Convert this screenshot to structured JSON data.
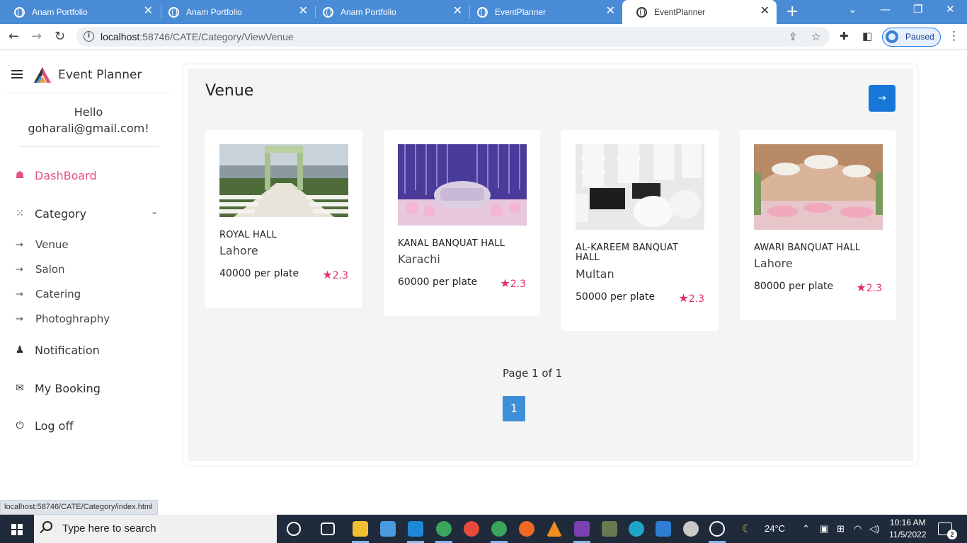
{
  "browser": {
    "tabs": [
      {
        "title": "Anam Portfolio"
      },
      {
        "title": "Anam Portfolio"
      },
      {
        "title": "Anam Portfolio"
      },
      {
        "title": "EventPlanner"
      },
      {
        "title": "EventPlanner"
      }
    ],
    "url_host": "localhost",
    "url_path": ":58746/CATE/Category/ViewVenue",
    "profile_status": "Paused",
    "status_url": "localhost:58746/CATE/Category/index.html"
  },
  "sidebar": {
    "brand": "Event Planner",
    "greeting": "Hello",
    "email": "goharali@gmail.com!",
    "items": [
      {
        "label": "DashBoard",
        "icon": "home-icon"
      },
      {
        "label": "Category",
        "icon": "grid-icon"
      },
      {
        "label": "Notification",
        "icon": "bell-icon"
      },
      {
        "label": "My Booking",
        "icon": "booking-icon"
      },
      {
        "label": "Log off",
        "icon": "power-icon"
      }
    ],
    "sub_items": [
      {
        "label": "Venue"
      },
      {
        "label": "Salon"
      },
      {
        "label": "Catering"
      },
      {
        "label": "Photoghraphy"
      }
    ]
  },
  "main": {
    "title": "Venue",
    "cards": [
      {
        "name": "ROYAL HALL",
        "city": "Lahore",
        "price": "40000 per plate",
        "rating": "2.3"
      },
      {
        "name": "KANAL BANQUAT HALL",
        "city": "Karachi",
        "price": "60000 per plate",
        "rating": "2.3"
      },
      {
        "name": "AL-KAREEM BANQUAT HALL",
        "city": "Multan",
        "price": "50000 per plate",
        "rating": "2.3"
      },
      {
        "name": "AWARI BANQUAT HALL",
        "city": "Lahore",
        "price": "80000 per plate",
        "rating": "2.3"
      }
    ],
    "page_info": "Page 1 of 1",
    "current_page": "1"
  },
  "taskbar": {
    "search_placeholder": "Type here to search",
    "temperature": "24°C",
    "time": "10:16 AM",
    "date": "11/5/2022",
    "notifications": "2"
  },
  "colors": {
    "accent_pink": "#e5527f",
    "button_blue": "#1677d9",
    "tab_strip": "#4a8bd6",
    "rating_red": "#e0306b"
  }
}
